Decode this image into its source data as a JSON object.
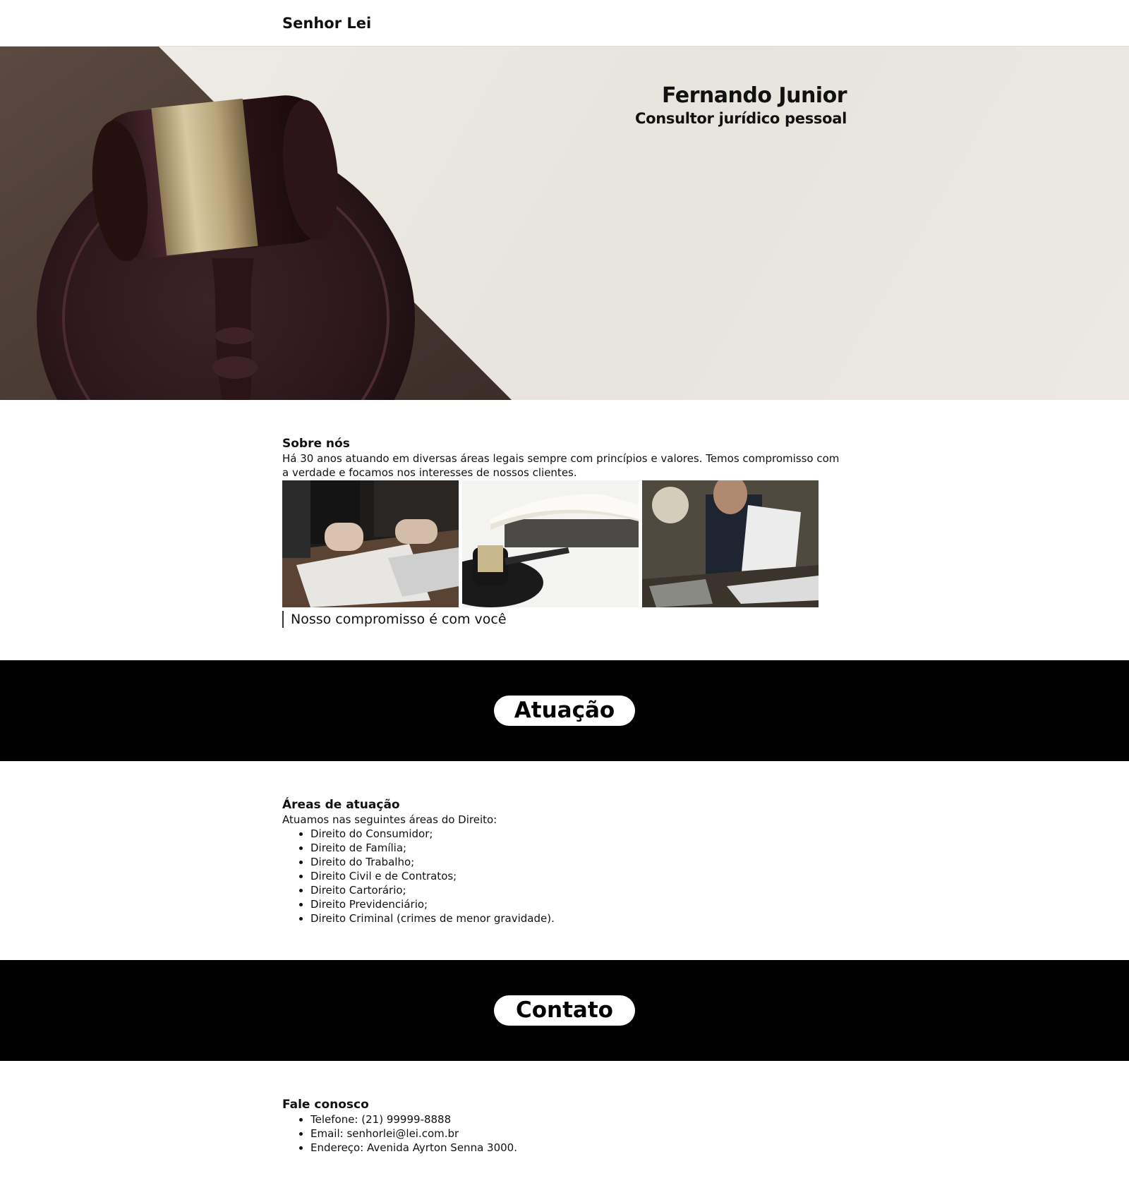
{
  "header": {
    "brand": "Senhor Lei"
  },
  "hero": {
    "name": "Fernando Junior",
    "role": "Consultor jurídico pessoal",
    "image": "gavel-on-sound-block-photo"
  },
  "about": {
    "title": "Sobre nós",
    "text": "Há 30 anos atuando em diversas áreas legais sempre com princípios e valores. Temos compromisso com a verdade e focamos nos interesses de nossos clientes.",
    "photos": [
      "signing-contract-photo",
      "gavel-and-book-photo",
      "lawyer-reading-document-photo"
    ],
    "quote": "Nosso compromisso é com você"
  },
  "band_atuacao": {
    "label": "Atuação"
  },
  "areas": {
    "title": "Áreas de atuação",
    "intro": "Atuamos nas seguintes áreas do Direito:",
    "items": [
      "Direito do Consumidor;",
      "Direito de Família;",
      "Direito do Trabalho;",
      "Direito Civil e de Contratos;",
      "Direito Cartorário;",
      "Direito Previdenciário;",
      "Direito Criminal (crimes de menor gravidade)."
    ]
  },
  "band_contato": {
    "label": "Contato"
  },
  "contact": {
    "title": "Fale conosco",
    "items": [
      "Telefone: (21) 99999-8888",
      "Email: senhorlei@lei.com.br",
      "Endereço: Avenida Ayrton Senna 3000."
    ]
  },
  "colors": {
    "band": "#000000",
    "pill": "#ffffff",
    "text": "#111111"
  }
}
